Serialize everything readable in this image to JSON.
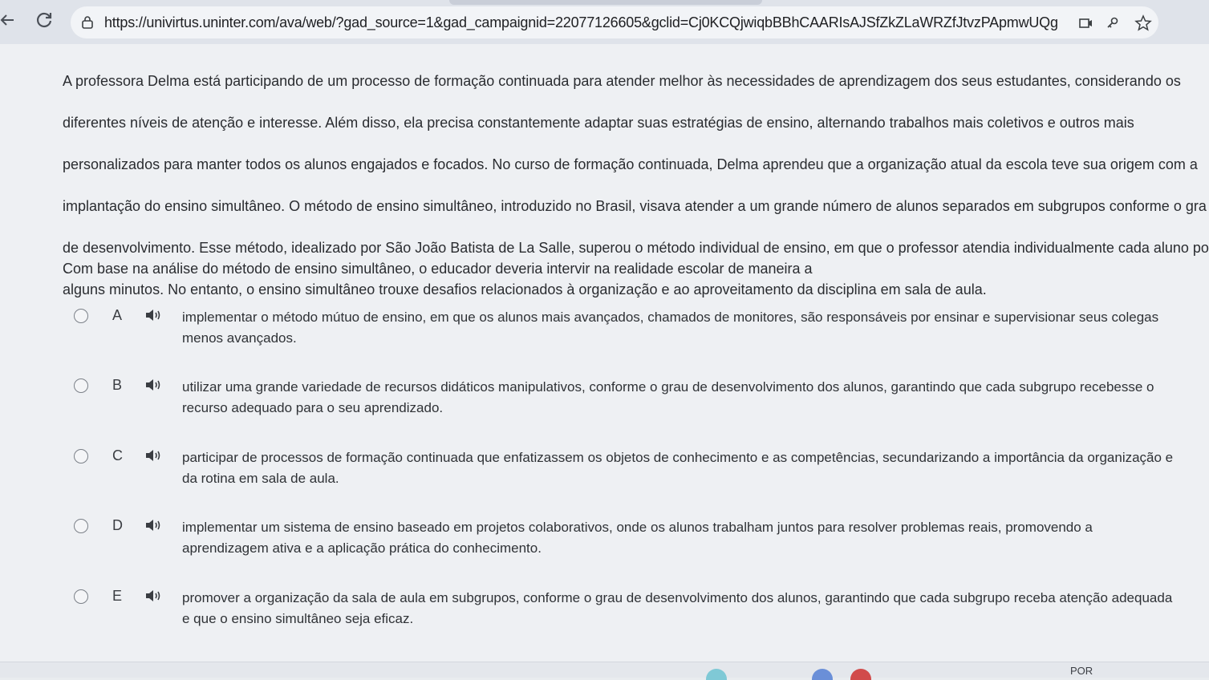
{
  "browser": {
    "url": "https://univirtus.uninter.com/ava/web/?gad_source=1&gad_campaignid=22077126605&gclid=Cj0KCQjwiqbBBhCAARIsAJSfZkZLaWRZfJtvzPApmwUQg..."
  },
  "statement": {
    "lines": [
      "A professora Delma está participando de um processo de formação continuada para atender melhor às necessidades de aprendizagem dos seus estudantes, considerando os",
      "diferentes níveis de atenção e interesse. Além disso, ela precisa constantemente adaptar suas estratégias de ensino, alternando trabalhos mais coletivos e outros mais",
      "personalizados para manter todos os alunos engajados e focados. No curso de formação continuada, Delma aprendeu que a organização atual da escola teve sua origem com a",
      "implantação do ensino simultâneo.  O método de ensino simultâneo, introduzido no Brasil, visava atender a um grande número de alunos separados em subgrupos conforme o gra",
      "de desenvolvimento. Esse método, idealizado por São João Batista de La Salle, superou o método individual de ensino, em que o professor atendia individualmente cada aluno po",
      "alguns minutos. No entanto, o ensino simultâneo trouxe desafios relacionados à organização e ao aproveitamento da disciplina em sala de aula."
    ]
  },
  "question": "Com base na análise do método de ensino simultâneo, o educador deveria intervir na realidade escolar de maneira a",
  "options": [
    {
      "letter": "A",
      "line1": "implementar o método mútuo de ensino, em que os alunos mais avançados, chamados de monitores, são responsáveis por ensinar e supervisionar seus colegas",
      "line2": "menos avançados."
    },
    {
      "letter": "B",
      "line1": "utilizar uma grande variedade de recursos didáticos manipulativos, conforme o grau de desenvolvimento dos alunos, garantindo que cada subgrupo recebesse o",
      "line2": "recurso adequado para o seu aprendizado."
    },
    {
      "letter": "C",
      "line1": "participar de processos de formação continuada que enfatizassem os objetos de conhecimento e as competências, secundarizando a importância da organização e",
      "line2": "da rotina em sala de aula."
    },
    {
      "letter": "D",
      "line1": "implementar um sistema de ensino baseado em projetos colaborativos, onde os alunos trabalham juntos para resolver problemas reais, promovendo a",
      "line2": "aprendizagem ativa e a aplicação prática do conhecimento."
    },
    {
      "letter": "E",
      "line1": "promover a organização da sala de aula em subgrupos, conforme o grau de desenvolvimento dos alunos, garantindo que cada subgrupo receba atenção adequada",
      "line2": "e que o ensino simultâneo seja eficaz."
    }
  ],
  "taskbar": {
    "language": "POR"
  },
  "colors": {
    "page_background": "#eef0f3",
    "browser_chrome": "#dfe3ea",
    "text": "#2a2c30"
  }
}
